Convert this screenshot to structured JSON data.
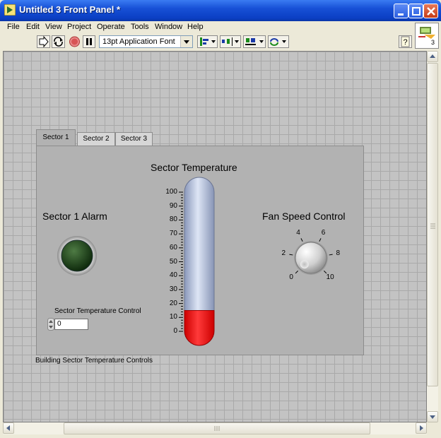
{
  "window": {
    "title": "Untitled 3 Front Panel *",
    "controls": [
      "minimize",
      "maximize",
      "close"
    ]
  },
  "menubar": {
    "items": [
      {
        "id": "file",
        "label": "File"
      },
      {
        "id": "edit",
        "label": "Edit"
      },
      {
        "id": "view",
        "label": "View"
      },
      {
        "id": "project",
        "label": "Project"
      },
      {
        "id": "operate",
        "label": "Operate"
      },
      {
        "id": "tools",
        "label": "Tools"
      },
      {
        "id": "window",
        "label": "Window"
      },
      {
        "id": "help",
        "label": "Help"
      }
    ]
  },
  "toolbar": {
    "font_select": "13pt Application Font",
    "buttons": [
      "run-arrow-icon",
      "run-continuously-icon",
      "abort-icon",
      "pause-icon",
      "align-icon",
      "distribute-icon",
      "resize-icon",
      "reorder-icon",
      "help-icon"
    ]
  },
  "vi_icon": {
    "label": "3"
  },
  "tabs": {
    "items": [
      {
        "id": "sector1",
        "label": "Sector 1",
        "active": true
      },
      {
        "id": "sector2",
        "label": "Sector 2",
        "active": false
      },
      {
        "id": "sector3",
        "label": "Sector 3",
        "active": false
      }
    ],
    "caption": "Building Sector Temperature Controls"
  },
  "alarm": {
    "label": "Sector 1 Alarm",
    "state": "off",
    "color": "#1f4a1c"
  },
  "thermometer": {
    "label": "Sector Temperature",
    "scale_labels": [
      "100",
      "90",
      "80",
      "70",
      "60",
      "50",
      "40",
      "30",
      "20",
      "10",
      "0"
    ],
    "min": 0,
    "max": 100,
    "value": 15,
    "fill_color": "#ff0000",
    "tube_color": "#a8b6d6"
  },
  "fan_knob": {
    "label": "Fan Speed Control",
    "scale_labels": [
      "0",
      "2",
      "4",
      "6",
      "8",
      "10"
    ],
    "value": 0
  },
  "temp_control": {
    "label": "Sector Temperature Control",
    "value": "0"
  }
}
